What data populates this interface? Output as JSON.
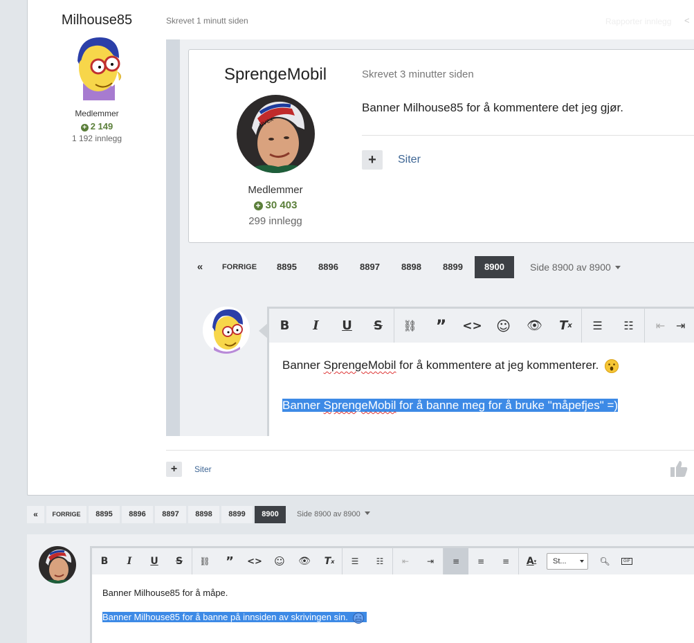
{
  "outer_post": {
    "author": "Milhouse85",
    "time": "Skrevet 1 minutt siden",
    "report": "Rapporter innlegg",
    "group": "Medlemmer",
    "reputation": "2 149",
    "post_count": "1 192 innlegg",
    "quote_button_label": "Siter"
  },
  "quoted_post": {
    "author": "SprengeMobil",
    "time": "Skrevet 3 minutter siden",
    "content": "Banner Milhouse85 for å kommentere det jeg gjør.",
    "group": "Medlemmer",
    "reputation": "30 403",
    "post_count": "299 innlegg",
    "quote_button_label": "Siter"
  },
  "pagination": {
    "prev_label": "FORRIGE",
    "pages": [
      "8895",
      "8896",
      "8897",
      "8898",
      "8899",
      "8900"
    ],
    "active": "8900",
    "page_indicator": "Side 8900 av 8900"
  },
  "inner_editor": {
    "line1_a": "Banner ",
    "line1_name": "SprengeMobil",
    "line1_b": " for å kommentere at jeg kommenterer.",
    "line2_a": "Banner ",
    "line2_name": "SprengeMobil",
    "line2_b": " for å banne meg for å bruke \"måpefjes\" =)"
  },
  "reply_editor": {
    "line1": "Banner Milhouse85 for å måpe.",
    "line2": "Banner Milhouse85 for å banne på innsiden av skrivingen sin.",
    "style_select": "St..."
  },
  "toolbar_icons": [
    "bold-icon",
    "italic-icon",
    "underline-icon",
    "strikethrough-icon",
    "link-icon",
    "quote-icon",
    "code-icon",
    "emoji-icon",
    "spoiler-icon",
    "clear-format-icon",
    "bullet-list-icon",
    "numbered-list-icon",
    "outdent-icon",
    "indent-icon",
    "align-left-icon",
    "align-center-icon",
    "align-right-icon",
    "font-color-icon",
    "preview-icon",
    "gif-icon"
  ],
  "colors": {
    "accent": "#3d6594",
    "reputation": "#5b7f3a",
    "selection": "#3d8ae6",
    "active_page": "#3d4045"
  }
}
